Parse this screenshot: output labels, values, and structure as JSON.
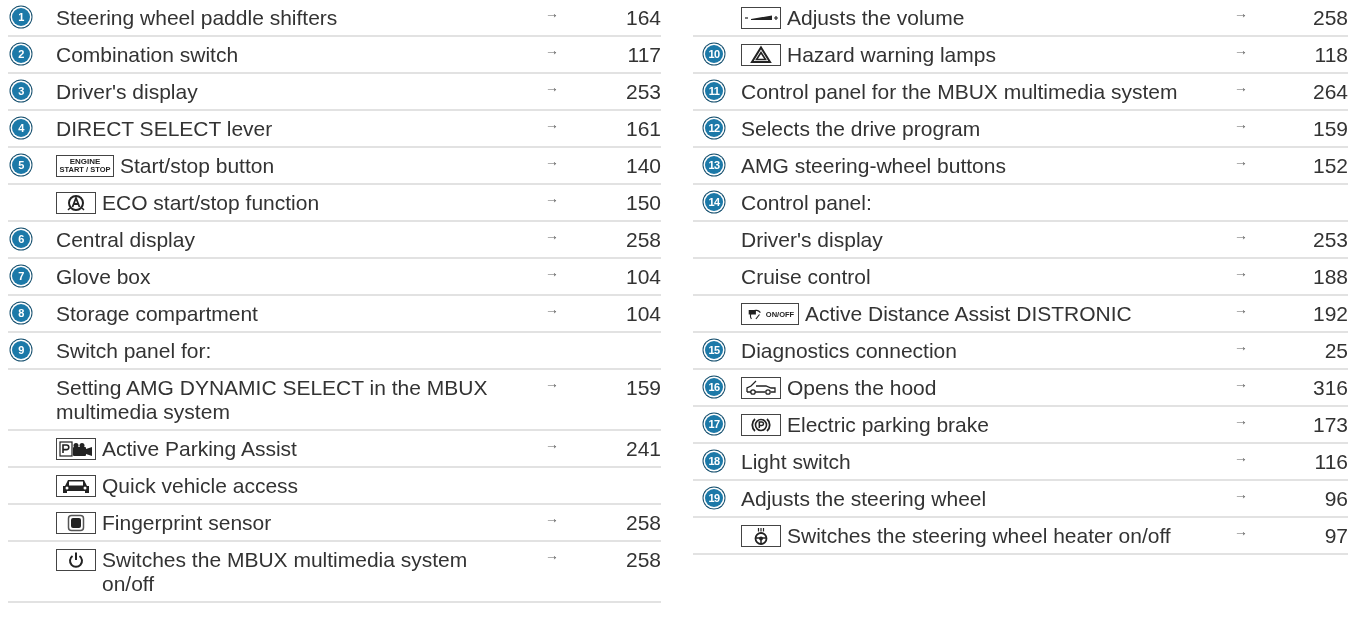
{
  "columns": [
    {
      "rows": [
        {
          "number": "1",
          "text": "Steering wheel paddle shifters",
          "arrow": "→",
          "page": "164"
        },
        {
          "number": "2",
          "text": "Combination switch",
          "arrow": "→",
          "page": "117"
        },
        {
          "number": "3",
          "text": "Driver's display",
          "arrow": "→",
          "page": "253"
        },
        {
          "number": "4",
          "text": "DIRECT SELECT lever",
          "arrow": "→",
          "page": "161"
        },
        {
          "number": "5",
          "kind": "engine-key",
          "key_text": [
            "ENGINE",
            "START / STOP"
          ],
          "text": "Start/stop button",
          "arrow": "→",
          "page": "140"
        },
        {
          "kind": "eco",
          "text": "ECO start/stop function",
          "arrow": "→",
          "page": "150"
        },
        {
          "number": "6",
          "text": "Central display",
          "arrow": "→",
          "page": "258"
        },
        {
          "number": "7",
          "text": "Glove box",
          "arrow": "→",
          "page": "104"
        },
        {
          "number": "8",
          "text": "Storage compartment",
          "arrow": "→",
          "page": "104"
        },
        {
          "number": "9",
          "text": "Switch panel for:"
        },
        {
          "text": "Setting AMG DYNAMIC SELECT in the MBUX multimedia system",
          "arrow": "→",
          "page": "159"
        },
        {
          "kind": "parking-camera",
          "text": "Active Parking Assist",
          "arrow": "→",
          "page": "241"
        },
        {
          "kind": "car-front",
          "text": "Quick vehicle access"
        },
        {
          "kind": "fingerprint",
          "text": "Fingerprint sensor",
          "arrow": "→",
          "page": "258"
        },
        {
          "kind": "power",
          "text": "Switches the MBUX multimedia system on/off",
          "arrow": "→",
          "page": "258"
        }
      ]
    },
    {
      "rows": [
        {
          "kind": "volume",
          "text": "Adjusts the volume",
          "arrow": "→",
          "page": "258"
        },
        {
          "number": "10",
          "kind": "hazard",
          "text": "Hazard warning lamps",
          "arrow": "→",
          "page": "118"
        },
        {
          "number": "11",
          "text": "Control panel for the MBUX multimedia system",
          "arrow": "→",
          "page": "264"
        },
        {
          "number": "12",
          "text": "Selects the drive program",
          "arrow": "→",
          "page": "159"
        },
        {
          "number": "13",
          "text": "AMG steering-wheel buttons",
          "arrow": "→",
          "page": "152"
        },
        {
          "number": "14",
          "text": "Control panel:"
        },
        {
          "text": "Driver's display",
          "arrow": "→",
          "page": "253"
        },
        {
          "text": "Cruise control",
          "arrow": "→",
          "page": "188"
        },
        {
          "kind": "distronic",
          "key_text": [
            "ON/OFF"
          ],
          "text": "Active Distance Assist DISTRONIC",
          "arrow": "→",
          "page": "192"
        },
        {
          "number": "15",
          "text": "Diagnostics connection",
          "arrow": "→",
          "page": "25"
        },
        {
          "number": "16",
          "kind": "hood",
          "text": "Opens the hood",
          "arrow": "→",
          "page": "316"
        },
        {
          "number": "17",
          "kind": "parking-brake",
          "text": "Electric parking brake",
          "arrow": "→",
          "page": "173"
        },
        {
          "number": "18",
          "text": "Light switch",
          "arrow": "→",
          "page": "116"
        },
        {
          "number": "19",
          "text": "Adjusts the steering wheel",
          "arrow": "→",
          "page": "96"
        },
        {
          "kind": "wheel-heater",
          "text": "Switches the steering wheel heater on/off",
          "arrow": "→",
          "page": "97"
        }
      ]
    }
  ]
}
